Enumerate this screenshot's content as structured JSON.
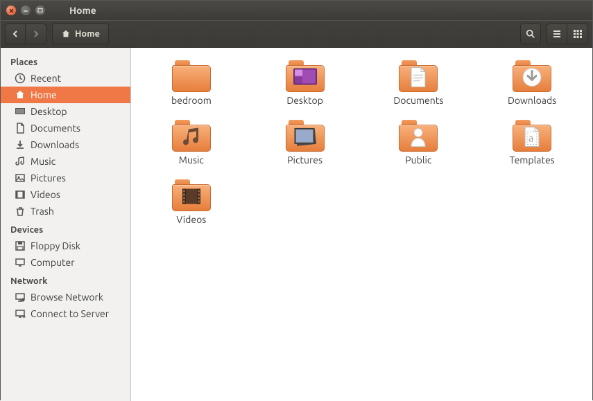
{
  "window": {
    "title": "Home"
  },
  "pathbar": {
    "current": "Home"
  },
  "sidebar": {
    "sections": [
      {
        "heading": "Places",
        "items": [
          {
            "label": "Recent",
            "icon": "clock"
          },
          {
            "label": "Home",
            "icon": "home",
            "active": true
          },
          {
            "label": "Desktop",
            "icon": "desktop"
          },
          {
            "label": "Documents",
            "icon": "document"
          },
          {
            "label": "Downloads",
            "icon": "download"
          },
          {
            "label": "Music",
            "icon": "music"
          },
          {
            "label": "Pictures",
            "icon": "picture"
          },
          {
            "label": "Videos",
            "icon": "video"
          },
          {
            "label": "Trash",
            "icon": "trash"
          }
        ]
      },
      {
        "heading": "Devices",
        "items": [
          {
            "label": "Floppy Disk",
            "icon": "floppy"
          },
          {
            "label": "Computer",
            "icon": "computer"
          }
        ]
      },
      {
        "heading": "Network",
        "items": [
          {
            "label": "Browse Network",
            "icon": "network"
          },
          {
            "label": "Connect to Server",
            "icon": "server"
          }
        ]
      }
    ]
  },
  "folders": [
    {
      "label": "bedroom",
      "emblem": "plain"
    },
    {
      "label": "Desktop",
      "emblem": "desktop"
    },
    {
      "label": "Documents",
      "emblem": "document"
    },
    {
      "label": "Downloads",
      "emblem": "download"
    },
    {
      "label": "Music",
      "emblem": "music"
    },
    {
      "label": "Pictures",
      "emblem": "picture"
    },
    {
      "label": "Public",
      "emblem": "public"
    },
    {
      "label": "Templates",
      "emblem": "template"
    },
    {
      "label": "Videos",
      "emblem": "video"
    }
  ]
}
